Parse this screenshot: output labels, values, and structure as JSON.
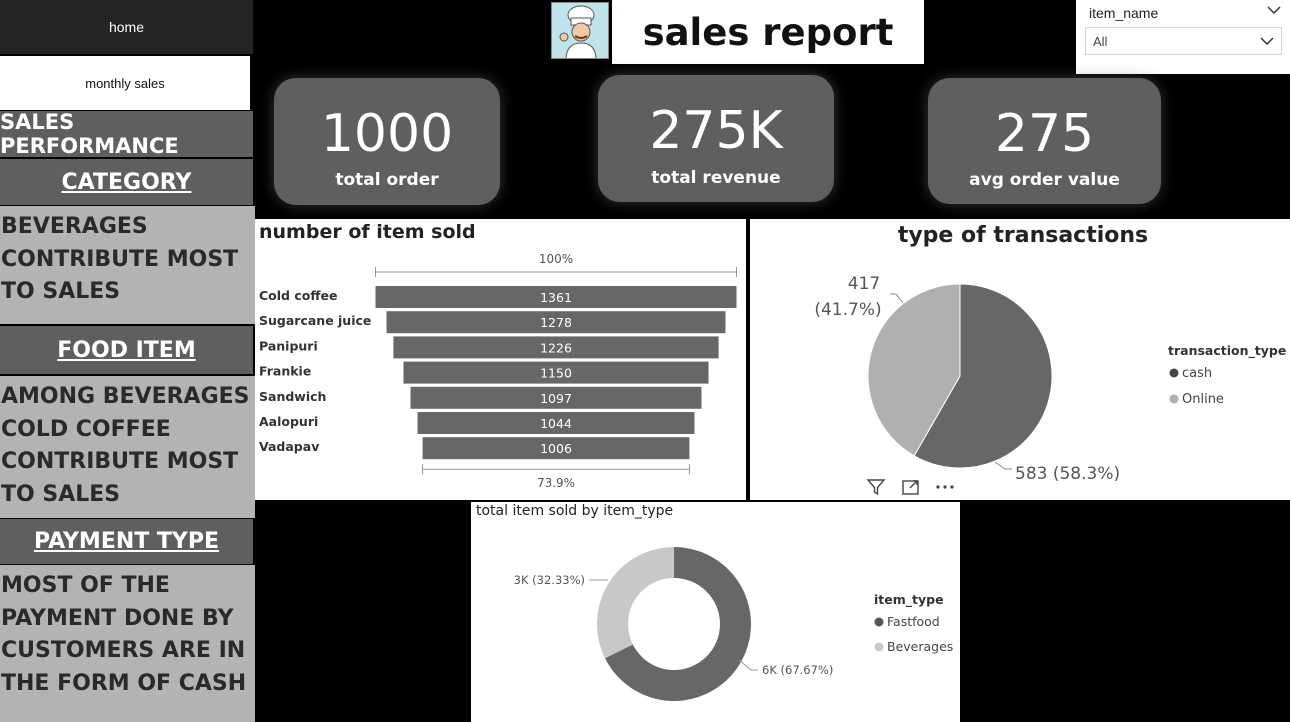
{
  "nav": {
    "home": "home",
    "monthly": "monthly sales"
  },
  "sidebar": {
    "section_title": "SALES PERFORMANCE",
    "category_head": "CATEGORY",
    "category_text": [
      "BEVERAGES",
      "CONTRIBUTE MOST",
      "TO SALES"
    ],
    "food_head": "FOOD ITEM",
    "food_text": [
      "AMONG BEVERAGES",
      "COLD COFFEE",
      "CONTRIBUTE MOST",
      "TO SALES"
    ],
    "payment_head": "PAYMENT TYPE",
    "payment_text": [
      "MOST OF THE",
      "PAYMENT DONE BY",
      "CUSTOMERS ARE IN",
      "THE FORM OF CASH"
    ]
  },
  "header": {
    "title": "sales report",
    "logo_icon": "chef-icon"
  },
  "slicer": {
    "label": "item_name",
    "value": "All"
  },
  "kpis": [
    {
      "value": "1000",
      "label": "total order"
    },
    {
      "value": "275K",
      "label": "total revenue"
    },
    {
      "value": "275",
      "label": "avg order value"
    }
  ],
  "colors": {
    "dark": "#676767",
    "light": "#b0b0b0",
    "donut_light": "#c8c8c8",
    "side_head": "#5f5f5f",
    "side_body": "#b3b3b3"
  },
  "chart_data": [
    {
      "type": "funnel",
      "title": "number of item sold",
      "categories": [
        "Cold coffee",
        "Sugarcane juice",
        "Panipuri",
        "Frankie",
        "Sandwich",
        "Aalopuri",
        "Vadapav"
      ],
      "values": [
        1361,
        1278,
        1226,
        1150,
        1097,
        1044,
        1006
      ],
      "top_label": "100%",
      "bottom_label": "73.9%"
    },
    {
      "type": "pie",
      "title": "type of transactions",
      "legend_title": "transaction_type",
      "slices": [
        {
          "name": "cash",
          "value": 583,
          "label": "583 (58.3%)"
        },
        {
          "name": "Online",
          "value": 417,
          "label_value": "417",
          "label_pct": "(41.7%)"
        }
      ]
    },
    {
      "type": "donut",
      "title": "total item sold by item_type",
      "legend_title": "item_type",
      "slices": [
        {
          "name": "Fastfood",
          "value": 67.67,
          "label": "6K (67.67%)"
        },
        {
          "name": "Beverages",
          "value": 32.33,
          "label": "3K (32.33%)"
        }
      ]
    }
  ]
}
